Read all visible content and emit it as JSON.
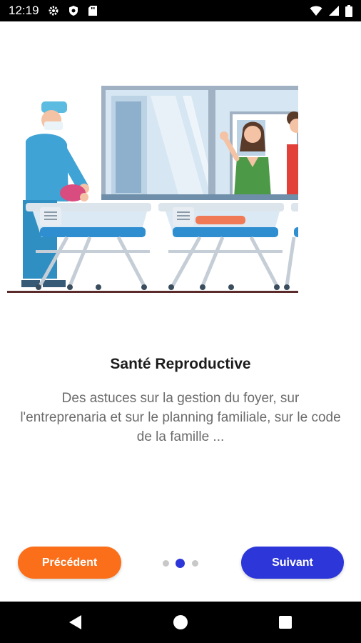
{
  "status_bar": {
    "time": "12:19",
    "icons": [
      "settings-icon",
      "shield-icon",
      "sd-card-icon",
      "wifi-icon",
      "signal-icon",
      "battery-icon"
    ]
  },
  "onboarding": {
    "illustration": "hospital-nursery-illustration",
    "title": "Santé Reproductive",
    "description": "Des astuces sur la gestion du foyer, sur l'entreprenaria et sur le planning familiale, sur le code de la famille ..."
  },
  "pager": {
    "total": 3,
    "active_index": 1,
    "active_color": "#2d37d9",
    "inactive_color": "#c8c8c8"
  },
  "buttons": {
    "previous_label": "Précédent",
    "previous_color": "#fb6f1a",
    "next_label": "Suivant",
    "next_color": "#2d37d9"
  },
  "nav_bar": {
    "icons": [
      "back-icon",
      "home-icon",
      "recents-icon"
    ]
  }
}
